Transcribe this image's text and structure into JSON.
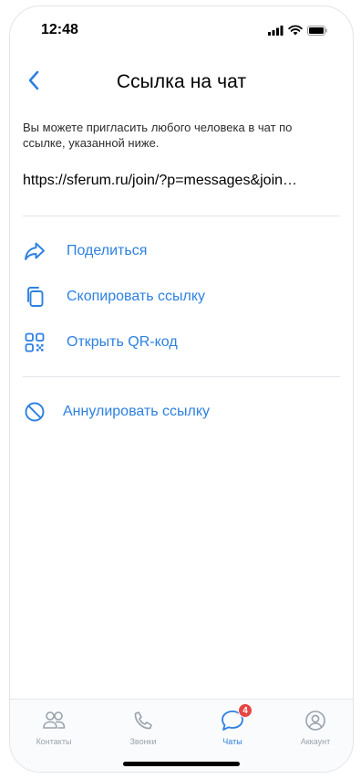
{
  "status_bar": {
    "time": "12:48",
    "icons": [
      "signal-icon",
      "wifi-icon",
      "battery-icon"
    ]
  },
  "header": {
    "title": "Ссылка на чат",
    "back_icon": "chevron-left-icon"
  },
  "description": "Вы можете пригласить любого человека в чат по ссылке, указанной ниже.",
  "link": "https://sferum.ru/join/?p=messages&join…",
  "actions": [
    {
      "label": "Поделиться",
      "icon": "share-icon"
    },
    {
      "label": "Скопировать ссылку",
      "icon": "copy-icon"
    },
    {
      "label": "Открыть QR-код",
      "icon": "qr-code-icon"
    }
  ],
  "revoke": {
    "label": "Аннулировать ссылку",
    "icon": "block-icon"
  },
  "tabs": [
    {
      "label": "Контакты",
      "icon": "contacts-icon",
      "active": false
    },
    {
      "label": "Звонки",
      "icon": "phone-icon",
      "active": false
    },
    {
      "label": "Чаты",
      "icon": "chat-icon",
      "active": true,
      "badge": "4"
    },
    {
      "label": "Аккаунт",
      "icon": "account-icon",
      "active": false
    }
  ],
  "colors": {
    "accent": "#2d81e0",
    "badge": "#e64646",
    "inactive": "#99a2ad"
  }
}
